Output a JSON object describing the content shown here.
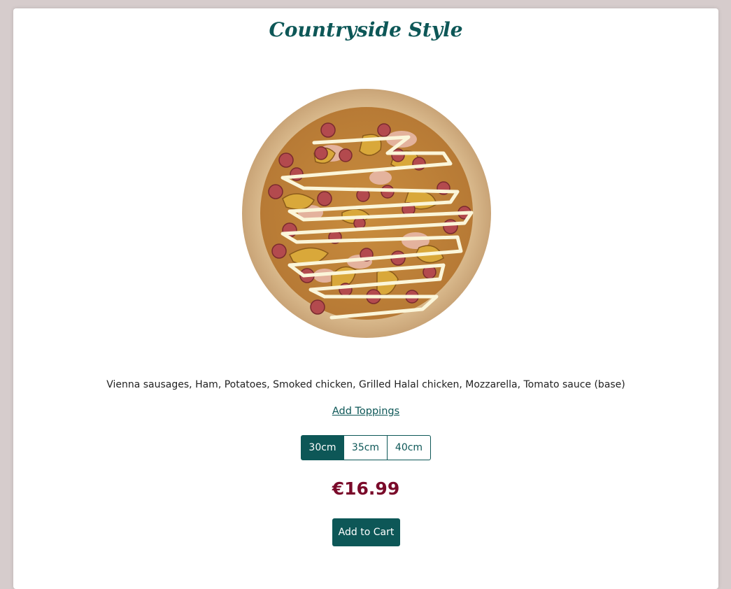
{
  "product": {
    "title": "Countryside Style",
    "description": "Vienna sausages, Ham, Potatoes, Smoked chicken, Grilled Halal chicken, Mozzarella, Tomato sauce (base)",
    "add_toppings_label": "Add Toppings",
    "sizes": [
      {
        "label": "30cm",
        "selected": true
      },
      {
        "label": "35cm",
        "selected": false
      },
      {
        "label": "40cm",
        "selected": false
      }
    ],
    "price": "€16.99",
    "add_to_cart_label": "Add to Cart"
  },
  "colors": {
    "accent": "#0d5757",
    "price": "#7a0a2a",
    "background": "#d6cccc"
  },
  "image": {
    "icon": "pizza-image"
  }
}
